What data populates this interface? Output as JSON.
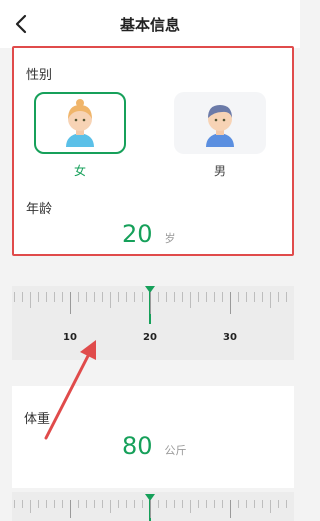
{
  "header": {
    "title": "基本信息",
    "back_icon": "chevron-left-icon"
  },
  "gender": {
    "label": "性别",
    "options": [
      {
        "label": "女",
        "selected": true,
        "icon": "female-avatar-icon"
      },
      {
        "label": "男",
        "selected": false,
        "icon": "male-avatar-icon"
      }
    ]
  },
  "age": {
    "label": "年龄",
    "value": "20",
    "unit": "岁",
    "ruler_labels": [
      "10",
      "20",
      "30"
    ]
  },
  "weight": {
    "label": "体重",
    "value": "80",
    "unit": "公斤"
  },
  "colors": {
    "accent": "#16a05a",
    "highlight_border": "#e04b4b",
    "annotation_arrow": "#e04b4b"
  }
}
